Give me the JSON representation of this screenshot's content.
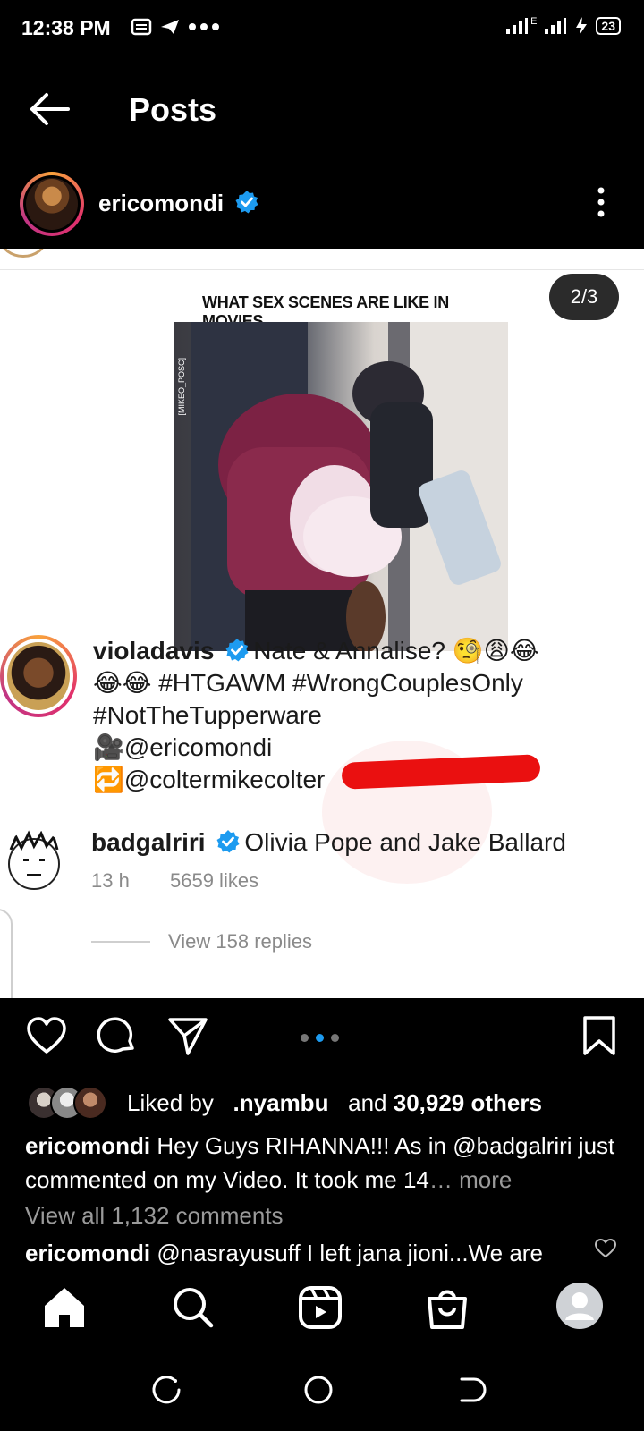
{
  "status": {
    "time": "12:38 PM",
    "battery": "23",
    "network_label": "E"
  },
  "header": {
    "title": "Posts"
  },
  "account": {
    "username": "ericomondi"
  },
  "post": {
    "page_counter": "2/3",
    "video_title": "WHAT SEX SCENES ARE LIKE IN MOVIES",
    "video_side_text": "[MIKEO_POSC]",
    "comments": [
      {
        "username": "violadavis",
        "text_line1": "Nate & Annalise? 🧐😩😂",
        "text_line2": "😂😂 #HTGAWM #WrongCouplesOnly",
        "text_line3": "#NotTheTupperware",
        "text_line4": "🎥@ericomondi",
        "text_line5": "🔁@coltermikecolter"
      },
      {
        "username": "badgalriri",
        "text": "Olivia Pope and Jake Ballard",
        "time": "13 h",
        "likes": "5659 likes",
        "view_replies": "View 158 replies"
      }
    ]
  },
  "engagement": {
    "liked_prefix": "Liked by ",
    "liked_user": "_.nyambu_",
    "liked_and": " and ",
    "liked_others": "30,929 others",
    "caption_user": "ericomondi",
    "caption_text": " Hey Guys RIHANNA!!! As in @badgalriri just commented on my Video. It took me 14",
    "caption_more": "… more",
    "view_all_comments": "View all 1,132 comments",
    "comment_user": "ericomondi",
    "comment_text": " @nasrayusuff I left jana jioni...We are"
  },
  "colors": {
    "verified_blue": "#1d9bf0",
    "highlight_red": "#ea1010",
    "background": "#000000"
  },
  "icons": [
    "back-arrow-icon",
    "verified-icon",
    "more-options-icon",
    "heart-icon",
    "comment-icon",
    "share-icon",
    "bookmark-icon",
    "home-icon",
    "search-icon",
    "reels-icon",
    "shop-icon",
    "profile-icon"
  ]
}
